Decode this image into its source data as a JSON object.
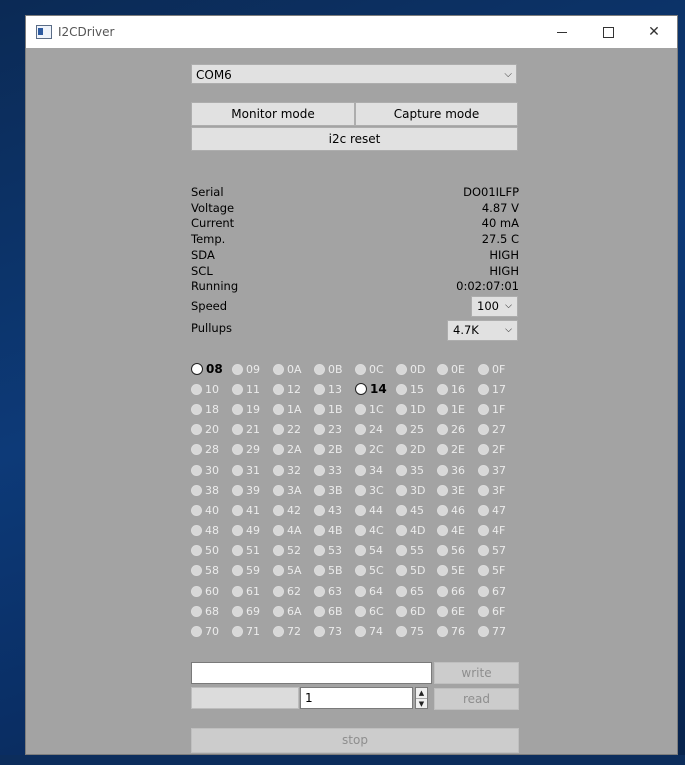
{
  "window": {
    "title": "I2CDriver",
    "controls": [
      "minimize-icon",
      "maximize-icon",
      "close-icon"
    ]
  },
  "port": {
    "selected": "COM6"
  },
  "buttons": {
    "monitor": "Monitor mode",
    "capture": "Capture mode",
    "reset": "i2c reset",
    "write": "write",
    "read": "read",
    "stop": "stop"
  },
  "info": [
    {
      "label": "Serial",
      "value": "DO01ILFP"
    },
    {
      "label": "Voltage",
      "value": "4.87 V"
    },
    {
      "label": "Current",
      "value": "40 mA"
    },
    {
      "label": "Temp.",
      "value": "27.5 C"
    },
    {
      "label": "SDA",
      "value": "HIGH"
    },
    {
      "label": "SCL",
      "value": "HIGH"
    },
    {
      "label": "Running",
      "value": "0:02:07:01"
    }
  ],
  "speed": {
    "label": "Speed",
    "value": "100"
  },
  "pullups": {
    "label": "Pullups",
    "value": "4.7K"
  },
  "addresses": [
    [
      "08",
      "09",
      "0A",
      "0B",
      "0C",
      "0D",
      "0E",
      "0F"
    ],
    [
      "10",
      "11",
      "12",
      "13",
      "14",
      "15",
      "16",
      "17"
    ],
    [
      "18",
      "19",
      "1A",
      "1B",
      "1C",
      "1D",
      "1E",
      "1F"
    ],
    [
      "20",
      "21",
      "22",
      "23",
      "24",
      "25",
      "26",
      "27"
    ],
    [
      "28",
      "29",
      "2A",
      "2B",
      "2C",
      "2D",
      "2E",
      "2F"
    ],
    [
      "30",
      "31",
      "32",
      "33",
      "34",
      "35",
      "36",
      "37"
    ],
    [
      "38",
      "39",
      "3A",
      "3B",
      "3C",
      "3D",
      "3E",
      "3F"
    ],
    [
      "40",
      "41",
      "42",
      "43",
      "44",
      "45",
      "46",
      "47"
    ],
    [
      "48",
      "49",
      "4A",
      "4B",
      "4C",
      "4D",
      "4E",
      "4F"
    ],
    [
      "50",
      "51",
      "52",
      "53",
      "54",
      "55",
      "56",
      "57"
    ],
    [
      "58",
      "59",
      "5A",
      "5B",
      "5C",
      "5D",
      "5E",
      "5F"
    ],
    [
      "60",
      "61",
      "62",
      "63",
      "64",
      "65",
      "66",
      "67"
    ],
    [
      "68",
      "69",
      "6A",
      "6B",
      "6C",
      "6D",
      "6E",
      "6F"
    ],
    [
      "70",
      "71",
      "72",
      "73",
      "74",
      "75",
      "76",
      "77"
    ]
  ],
  "active_addresses": [
    "08",
    "14"
  ],
  "write_input": {
    "value": ""
  },
  "read_count": {
    "value": "1"
  },
  "read_output": {
    "value": ""
  }
}
